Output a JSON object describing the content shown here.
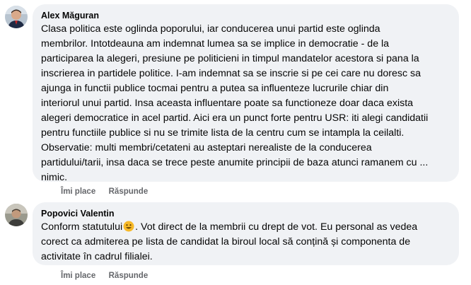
{
  "comments": [
    {
      "author": "Alex Măguran",
      "lines": [
        "Clasa politica este oglinda poporului, iar conducerea unui partid este oglinda",
        "membrilor. Intotdeauna am indemnat lumea sa se implice in democratie - de la",
        "participarea la alegeri, presiune pe politicieni in timpul mandatelor acestora si pana la",
        "inscrierea in partidele politice. I-am indemnat sa se inscrie si pe cei care nu doresc sa",
        "ajunga in functii publice tocmai pentru a putea sa influenteze lucrurile chiar din",
        "interiorul unui partid. Insa aceasta influentare poate sa functioneze doar daca exista",
        "alegeri democratice in acel partid. Aici era un punct forte pentru USR: iti alegi candidatii",
        "pentru functiile publice si nu se trimite lista de la centru cum se intampla la ceilalti.",
        "Observatie: multi membri/cetateni au asteptari nerealiste de la conducerea",
        "partidului/tarii, insa daca se trece peste anumite principii de baza atunci ramanem cu ...",
        "nimic."
      ],
      "like_label": "Îmi place",
      "reply_label": "Răspunde"
    },
    {
      "author": "Popovici Valentin",
      "lines": [
        "Conform statutului",
        ". Vot direct de la membrii cu drept de vot. Eu personal as vedea",
        "corect ca admiterea pe lista de candidat la biroul local să conțină și componenta de",
        "activitate în cadrul filialei."
      ],
      "emoji_icon": "smile-emoji-icon",
      "like_label": "Îmi place",
      "reply_label": "Răspunde"
    }
  ],
  "colors": {
    "bubble_bg": "#f0f2f5",
    "text": "#050505",
    "action_text": "#65676b",
    "emoji_fill": "#f7b928"
  }
}
